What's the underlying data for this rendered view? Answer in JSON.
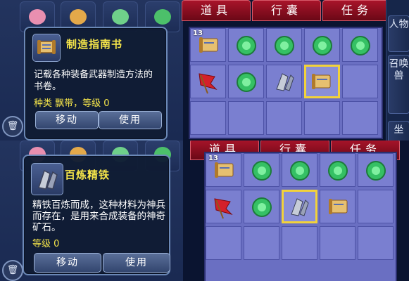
{
  "top": {
    "tooltip": {
      "title": "制造指南书",
      "description": "记载各种装备武器制造方法的书卷。",
      "meta": "种类 飘带，等级 0",
      "move_label": "移动",
      "use_label": "使用"
    },
    "tabs": [
      "道具",
      "行囊",
      "任务"
    ],
    "side_tabs": [
      "人物",
      "召唤兽",
      "坐"
    ],
    "stack_count": "13"
  },
  "bottom": {
    "tooltip": {
      "title": "百炼精铁",
      "description": "精铁百炼而成，这种材料为神兵而存在，是用来合成装备的神奇矿石。",
      "meta": "等级 0",
      "move_label": "移动",
      "use_label": "使用"
    },
    "tabs": [
      "道具",
      "行囊",
      "任务"
    ],
    "stack_count": "13"
  },
  "colors": {
    "title_yellow": "#f6e64a",
    "tab_red": "#a8142a",
    "grid_purple": "#7a7fd0",
    "select_gold": "#f2d23a"
  }
}
